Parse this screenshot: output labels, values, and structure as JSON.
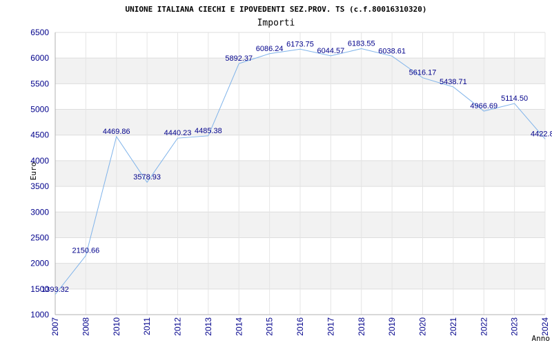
{
  "chart_data": {
    "type": "line",
    "title": "UNIONE ITALIANA CIECHI E IPOVEDENTI SEZ.PROV. TS (c.f.80016310320)",
    "subtitle": "Importi",
    "xlabel": "Anno",
    "ylabel": "Euro",
    "ylim": [
      1000,
      6500
    ],
    "yticks": [
      "6500",
      "6000",
      "5500",
      "5000",
      "4500",
      "4000",
      "3500",
      "3000",
      "2500",
      "2000",
      "1500",
      "1000"
    ],
    "categories": [
      "2007",
      "2008",
      "2010",
      "2011",
      "2012",
      "2013",
      "2014",
      "2015",
      "2016",
      "2017",
      "2018",
      "2019",
      "2020",
      "2021",
      "2022",
      "2023",
      "2024"
    ],
    "values": [
      1393.32,
      2150.66,
      4469.86,
      3578.93,
      4440.23,
      4485.38,
      5892.37,
      6086.24,
      6173.75,
      6044.57,
      6183.55,
      6038.61,
      5616.17,
      5438.71,
      4966.69,
      5114.5,
      4422.8
    ],
    "value_labels": [
      "1393.32",
      "2150.66",
      "4469.86",
      "3578.93",
      "4440.23",
      "4485.38",
      "5892.37",
      "6086.24",
      "6173.75",
      "6044.57",
      "6183.55",
      "6038.61",
      "5616.17",
      "5438.71",
      "4966.69",
      "5114.50",
      "4422.8"
    ],
    "grid": true,
    "legend": "none",
    "colors": {
      "line": "#7fb3ea",
      "tick_text": "#00008b",
      "band": "#f2f2f2"
    }
  }
}
